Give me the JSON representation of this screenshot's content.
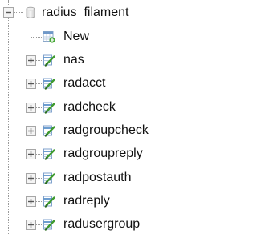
{
  "database": {
    "name": "radius_filament",
    "icon": "database-icon",
    "expanded": true
  },
  "new_item": {
    "label": "New",
    "icon": "new-table-icon"
  },
  "tables": [
    {
      "label": "nas",
      "icon": "table-icon"
    },
    {
      "label": "radacct",
      "icon": "table-icon"
    },
    {
      "label": "radcheck",
      "icon": "table-icon"
    },
    {
      "label": "radgroupcheck",
      "icon": "table-icon"
    },
    {
      "label": "radgroupreply",
      "icon": "table-icon"
    },
    {
      "label": "radpostauth",
      "icon": "table-icon"
    },
    {
      "label": "radreply",
      "icon": "table-icon"
    },
    {
      "label": "radusergroup",
      "icon": "table-icon"
    }
  ],
  "colors": {
    "table_icon_blue": "#4a86c5",
    "table_icon_green": "#3f9b2f",
    "connector": "#9a9a9a"
  }
}
